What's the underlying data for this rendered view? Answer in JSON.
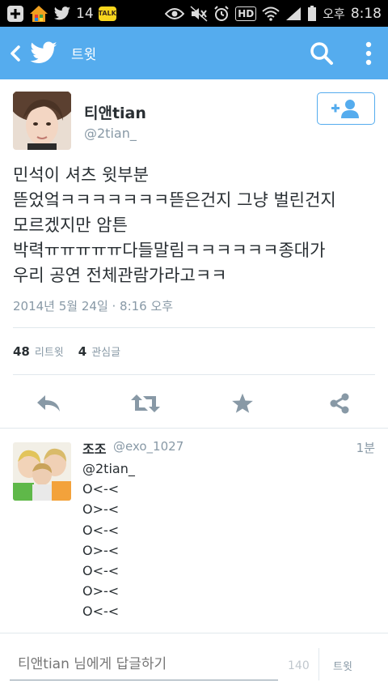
{
  "status_bar": {
    "notification_count": "14",
    "kakao_label": "TALK",
    "hd_label": "HD",
    "ampm": "오후",
    "time": "8:18"
  },
  "app_bar": {
    "title": "트윗",
    "background": "#55acee"
  },
  "tweet": {
    "author_name": "티앤tian",
    "author_handle": "@2tian_",
    "text_lines": [
      "민석이 셔츠 윗부분",
      "뜯었엌ㅋㅋㅋㅋㅋㅋㅋ뜯은건지 그냥 벌린건지",
      "모르겠지만 암튼",
      "박력ㅠㅠㅠㅠㅠ다들말림ㅋㅋㅋㅋㅋㅋ종대가",
      "우리 공연 전체관람가라고ㅋㅋ"
    ],
    "timestamp": "2014년 5월 24일 · 8:16 오후",
    "retweets_count": "48",
    "retweets_label": "리트윗",
    "favorites_count": "4",
    "favorites_label": "관심글"
  },
  "reply": {
    "author_name": "조조",
    "author_handle": "@exo_1027",
    "time": "1분",
    "lines": [
      "@2tian_",
      "O<-<",
      "O>-<",
      "O<-<",
      "O>-<",
      "O<-<",
      "O>-<",
      "O<-<"
    ]
  },
  "composer": {
    "placeholder": "티앤tian 님에게 답글하기",
    "char_count": "140",
    "send_label": "트윗"
  },
  "icons": {
    "accent": "#55acee",
    "action_color": "#8899a6"
  }
}
